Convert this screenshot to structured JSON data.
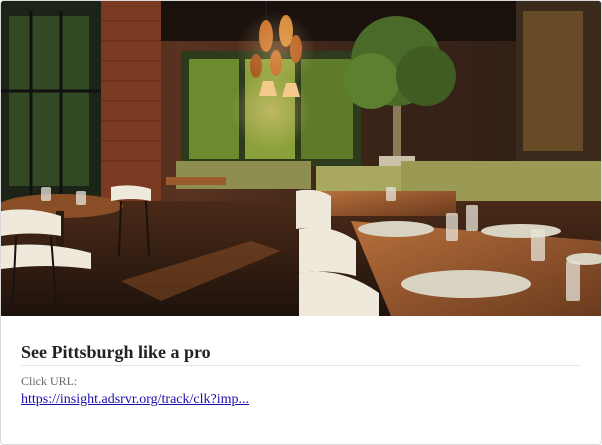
{
  "card": {
    "image_alt": "Restaurant dining room interior with wooden tables, white chairs, green booths, hanging lamps and a tree",
    "title": "See Pittsburgh like a pro",
    "url_label": "Click URL:",
    "url_text": "https://insight.adsrvr.org/track/clk?imp...",
    "url_href": "https://insight.adsrvr.org/track/clk?imp..."
  },
  "colors": {
    "title": "#222222",
    "label": "#666666",
    "link": "#1a0dab",
    "border": "#d9d9d9"
  }
}
